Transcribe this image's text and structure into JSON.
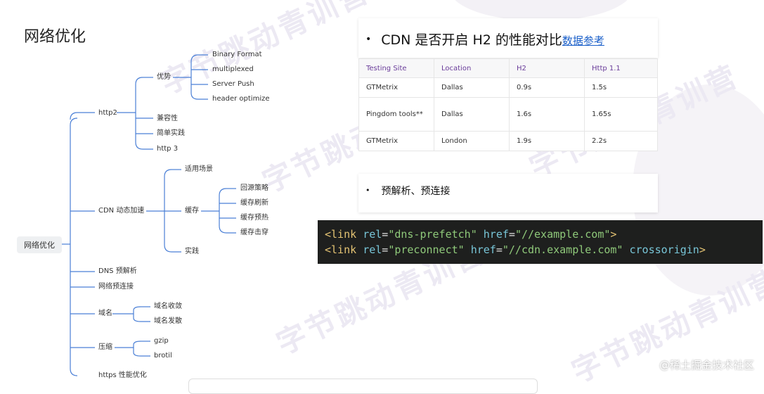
{
  "page": {
    "title": "网络优化"
  },
  "mindmap": {
    "root": "网络优化",
    "http2": {
      "label": "http2",
      "advantages": {
        "label": "优势",
        "items": [
          "Binary Format",
          "multiplexed",
          "Server Push",
          "header optimize"
        ]
      },
      "compat": "兼容性",
      "practice": "简单实践",
      "http3": "http 3"
    },
    "cdn": {
      "label": "CDN 动态加速",
      "scenario": "适用场景",
      "cache": {
        "label": "缓存",
        "items": [
          "回源策略",
          "缓存刷新",
          "缓存预热",
          "缓存击穿"
        ]
      },
      "practice": "实践"
    },
    "dns": "DNS 预解析",
    "preconnect": "网络预连接",
    "domain": {
      "label": "域名",
      "items": [
        "域名收敛",
        "域名发散"
      ]
    },
    "compress": {
      "label": "压缩",
      "items": [
        "gzip",
        "brotil"
      ]
    },
    "https": "https 性能优化"
  },
  "cdn_card": {
    "bullet": "•",
    "text": "CDN 是否开启 H2 的性能对比",
    "link": "数据参考"
  },
  "table": {
    "headers": [
      "Testing Site",
      "Location",
      "H2",
      "Http 1.1"
    ],
    "rows": [
      [
        "GTMetrix",
        "Dallas",
        "0.9s",
        "1.5s"
      ],
      [
        "Pingdom tools**",
        "Dallas",
        "1.6s",
        "1.65s"
      ],
      [
        "GTMetrix",
        "London",
        "1.9s",
        "2.2s"
      ]
    ]
  },
  "prefetch_card": {
    "bullet": "•",
    "text": "预解析、预连接"
  },
  "code": {
    "line1": {
      "tag": "<link",
      "a1": "rel",
      "v1": "\"dns-prefetch\"",
      "a2": "href",
      "v2": "\"//example.com\"",
      "end": ">"
    },
    "line2": {
      "tag": "<link",
      "a1": "rel",
      "v1": "\"preconnect\"",
      "a2": "href",
      "v2": "\"//cdn.example.com\"",
      "a3": "crossorigin",
      "end": ">"
    }
  },
  "watermark": "字节跳动青训营",
  "credit": "@稀土掘金技术社区",
  "colors": {
    "line": "#4a7fd6",
    "header_text": "#6a3d9a",
    "code_bg": "#1e1f1e",
    "link": "#1a5fc9"
  }
}
